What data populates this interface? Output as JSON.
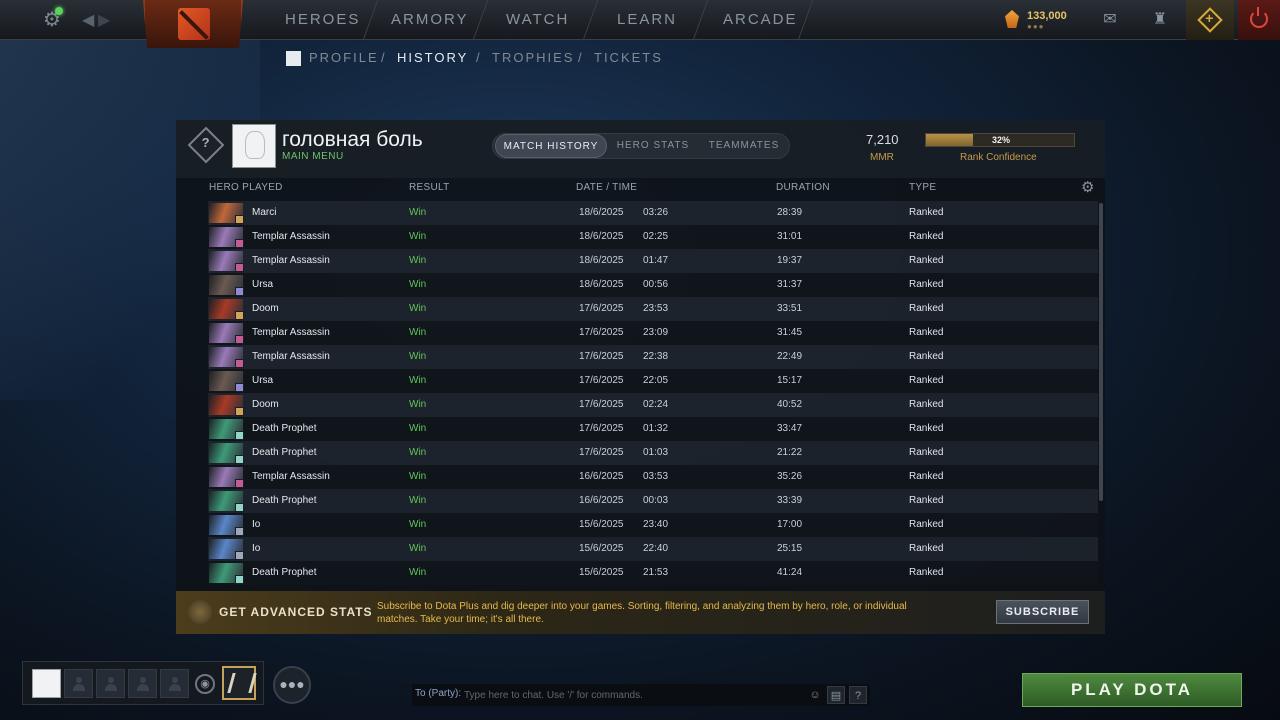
{
  "colors": {
    "win": "#61c45a",
    "accent_gold": "#c39a4f",
    "promo_text": "#e7b94b",
    "play_green": "#4f8a3f",
    "online": "#5cd35c"
  },
  "topnav": {
    "items": [
      "HEROES",
      "ARMORY",
      "WATCH",
      "LEARN",
      "ARCADE"
    ],
    "shards": "133,000",
    "icons": [
      "settings-gear-icon",
      "back-arrow-icon",
      "forward-arrow-icon",
      "dota-logo-icon",
      "shards-icon",
      "mail-icon",
      "armory-icon",
      "dota-plus-icon",
      "power-icon"
    ]
  },
  "subnav": {
    "profile": "PROFILE",
    "history": "HISTORY",
    "trophies": "TROPHIES",
    "tickets": "TICKETS",
    "separator": "/"
  },
  "profile": {
    "name": "головная боль",
    "status": "MAIN MENU",
    "badge": "?",
    "tabs": [
      "MATCH HISTORY",
      "HERO STATS",
      "TEAMMATES"
    ],
    "active_tab": "MATCH HISTORY",
    "mmr": "7,210",
    "mmr_label": "MMR",
    "rank_confidence": 0.32,
    "rank_confidence_text": "32%",
    "rank_confidence_label": "Rank Confidence"
  },
  "table": {
    "headers": {
      "hero": "HERO PLAYED",
      "result": "RESULT",
      "datetime": "DATE / TIME",
      "duration": "DURATION",
      "type": "TYPE"
    },
    "rows": [
      {
        "hero": "Marci",
        "result": "Win",
        "date": "18/6/2025",
        "time": "03:26",
        "duration": "28:39",
        "type": "Ranked",
        "color": "#c0683a",
        "badge": "#d2a45a"
      },
      {
        "hero": "Templar Assassin",
        "result": "Win",
        "date": "18/6/2025",
        "time": "02:25",
        "duration": "31:01",
        "type": "Ranked",
        "color": "#9a7ab8",
        "badge": "#c25a96"
      },
      {
        "hero": "Templar Assassin",
        "result": "Win",
        "date": "18/6/2025",
        "time": "01:47",
        "duration": "19:37",
        "type": "Ranked",
        "color": "#9a7ab8",
        "badge": "#c25a96"
      },
      {
        "hero": "Ursa",
        "result": "Win",
        "date": "18/6/2025",
        "time": "00:56",
        "duration": "31:37",
        "type": "Ranked",
        "color": "#6b5a52",
        "badge": "#8f8ad6"
      },
      {
        "hero": "Doom",
        "result": "Win",
        "date": "17/6/2025",
        "time": "23:53",
        "duration": "33:51",
        "type": "Ranked",
        "color": "#a83a26",
        "badge": "#d2a45a"
      },
      {
        "hero": "Templar Assassin",
        "result": "Win",
        "date": "17/6/2025",
        "time": "23:09",
        "duration": "31:45",
        "type": "Ranked",
        "color": "#9a7ab8",
        "badge": "#c25a96"
      },
      {
        "hero": "Templar Assassin",
        "result": "Win",
        "date": "17/6/2025",
        "time": "22:38",
        "duration": "22:49",
        "type": "Ranked",
        "color": "#9a7ab8",
        "badge": "#c25a96"
      },
      {
        "hero": "Ursa",
        "result": "Win",
        "date": "17/6/2025",
        "time": "22:05",
        "duration": "15:17",
        "type": "Ranked",
        "color": "#6b5a52",
        "badge": "#8f8ad6"
      },
      {
        "hero": "Doom",
        "result": "Win",
        "date": "17/6/2025",
        "time": "02:24",
        "duration": "40:52",
        "type": "Ranked",
        "color": "#a83a26",
        "badge": "#d2a45a"
      },
      {
        "hero": "Death Prophet",
        "result": "Win",
        "date": "17/6/2025",
        "time": "01:32",
        "duration": "33:47",
        "type": "Ranked",
        "color": "#3f9a78",
        "badge": "#8fd6c8"
      },
      {
        "hero": "Death Prophet",
        "result": "Win",
        "date": "17/6/2025",
        "time": "01:03",
        "duration": "21:22",
        "type": "Ranked",
        "color": "#3f9a78",
        "badge": "#8fd6c8"
      },
      {
        "hero": "Templar Assassin",
        "result": "Win",
        "date": "16/6/2025",
        "time": "03:53",
        "duration": "35:26",
        "type": "Ranked",
        "color": "#9a7ab8",
        "badge": "#c25a96"
      },
      {
        "hero": "Death Prophet",
        "result": "Win",
        "date": "16/6/2025",
        "time": "00:03",
        "duration": "33:39",
        "type": "Ranked",
        "color": "#3f9a78",
        "badge": "#8fd6c8"
      },
      {
        "hero": "Io",
        "result": "Win",
        "date": "15/6/2025",
        "time": "23:40",
        "duration": "17:00",
        "type": "Ranked",
        "color": "#5a86c8",
        "badge": "#9fa8b8"
      },
      {
        "hero": "Io",
        "result": "Win",
        "date": "15/6/2025",
        "time": "22:40",
        "duration": "25:15",
        "type": "Ranked",
        "color": "#5a86c8",
        "badge": "#9fa8b8"
      },
      {
        "hero": "Death Prophet",
        "result": "Win",
        "date": "15/6/2025",
        "time": "21:53",
        "duration": "41:24",
        "type": "Ranked",
        "color": "#3f9a78",
        "badge": "#8fd6c8"
      }
    ]
  },
  "promo": {
    "title": "GET ADVANCED STATS",
    "text": "Subscribe to Dota Plus and dig deeper into your games. Sorting, filtering, and analyzing them by hero, role, or individual matches. Take your time; it's all there.",
    "button": "SUBSCRIBE"
  },
  "chat": {
    "target": "To (Party):",
    "placeholder": "Type here to chat. Use '/' for commands.",
    "help": "?"
  },
  "play_button": "PLAY DOTA"
}
